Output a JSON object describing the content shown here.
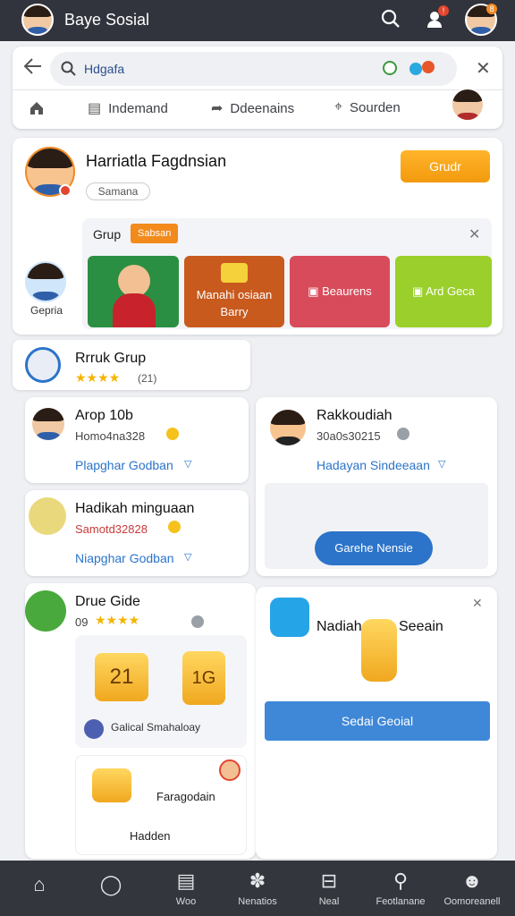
{
  "header": {
    "title": "Baye Sosial",
    "notif_badge": "!",
    "avatar_badge": "8"
  },
  "search": {
    "value": "Hdgafa",
    "back_icon": "back-arrow-icon",
    "clear_icon": "close-icon"
  },
  "tabs": [
    {
      "label": "Indemand"
    },
    {
      "label": "Ddeenains"
    },
    {
      "label": "Sourden"
    }
  ],
  "profile": {
    "name": "Harriatla Fagdnsian",
    "pill": "Samana",
    "action": "Grudr",
    "side_label": "Gepria"
  },
  "group_strip": {
    "label": "Grup",
    "tag": "Sabsan",
    "tiles": [
      {
        "label": ""
      },
      {
        "label": "Manahi osiaan Barry"
      },
      {
        "label": "Beaurens"
      },
      {
        "label": "Ard Geca"
      }
    ],
    "colors": [
      "#c85a1e",
      "#d84b5a",
      "#9bcf2b"
    ]
  },
  "left_col": {
    "group": {
      "title": "Rrruk Grup",
      "count": "(21)"
    },
    "item1": {
      "name": "Arop 10b",
      "sub": "Homo4na328",
      "link": "Plapghar Godban"
    },
    "item2": {
      "name": "Hadikah minguaan",
      "sub": "Samotd32828",
      "link": "Niapghar Godban"
    },
    "item3": {
      "name": "Drue Gide",
      "sub": "09",
      "card_labels": [
        "21",
        "1G"
      ],
      "card_footer": "Galical Smahaloay",
      "card2_label": "Faragodain",
      "card2_label2": "Hadden"
    }
  },
  "right_col": {
    "item1": {
      "name": "Rakkoudiah",
      "sub": "30a0s30215",
      "link": "Hadayan Sindeeaan",
      "button": "Garehe Nensie"
    },
    "item2": {
      "name": "Nadiah",
      "label2": "Seeain",
      "button": "Sedai Geoial"
    }
  },
  "bottom_nav": [
    {
      "icon": "home-icon",
      "label": ""
    },
    {
      "icon": "search-icon",
      "label": ""
    },
    {
      "icon": "calendar-icon",
      "label": "Woo"
    },
    {
      "icon": "game-icon",
      "label": "Nenatios"
    },
    {
      "icon": "message-icon",
      "label": "Neal"
    },
    {
      "icon": "location-icon",
      "label": "Feotlanane"
    },
    {
      "icon": "profile-icon",
      "label": "Oomoreanell"
    }
  ]
}
